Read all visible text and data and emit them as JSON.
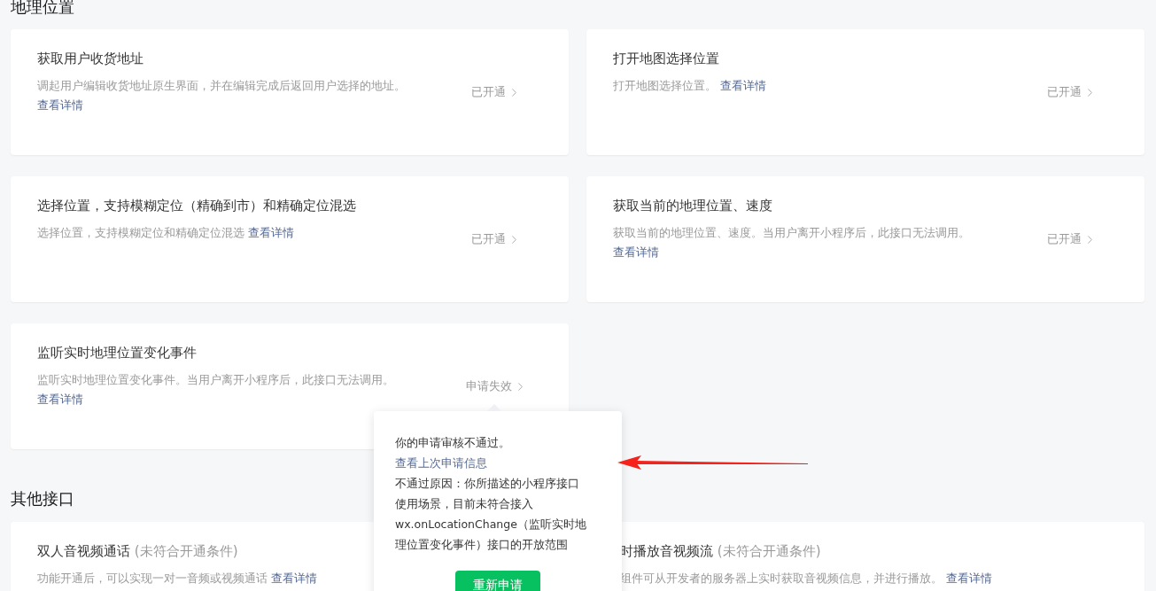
{
  "sections": [
    {
      "title": "地理位置",
      "cards": [
        {
          "title": "获取用户收货地址",
          "description": "调起用户编辑收货地址原生界面，并在编辑完成后返回用户选择的地址。 ",
          "link": "查看详情",
          "status": "已开通"
        },
        {
          "title": "打开地图选择位置",
          "description": "打开地图选择位置。 ",
          "link": "查看详情",
          "status": "已开通"
        },
        {
          "title": "选择位置，支持模糊定位（精确到市）和精确定位混选",
          "description": "选择位置，支持模糊定位和精确定位混选 ",
          "link": "查看详情",
          "status": "已开通"
        },
        {
          "title": "获取当前的地理位置、速度",
          "description": "获取当前的地理位置、速度。当用户离开小程序后，此接口无法调用。 ",
          "link": "查看详情",
          "status": "已开通"
        },
        {
          "title": "监听实时地理位置变化事件",
          "description": "监听实时地理位置变化事件。当用户离开小程序后，此接口无法调用。 ",
          "link": "查看详情",
          "status": "申请失效"
        }
      ]
    },
    {
      "title": "其他接口",
      "cards": [
        {
          "title": "双人音视频通话",
          "title_note": "(未符合开通条件)",
          "description": "功能开通后，可以实现一对一音频或视频通话 ",
          "link": "查看详情"
        },
        {
          "title": "时播放音视频流",
          "title_note": "(未符合开通条件)",
          "description": "组件可从开发者的服务器上实时获取音视频信息，并进行播放。 ",
          "link": "查看详情"
        }
      ]
    }
  ],
  "popover": {
    "message": "你的申请审核不通过。 ",
    "link": "查看上次申请信息",
    "reason": "不通过原因：你所描述的小程序接口使用场景，目前未符合接入wx.onLocationChange（监听实时地理位置变化事件）接口的开放范围",
    "button": "重新申请"
  }
}
